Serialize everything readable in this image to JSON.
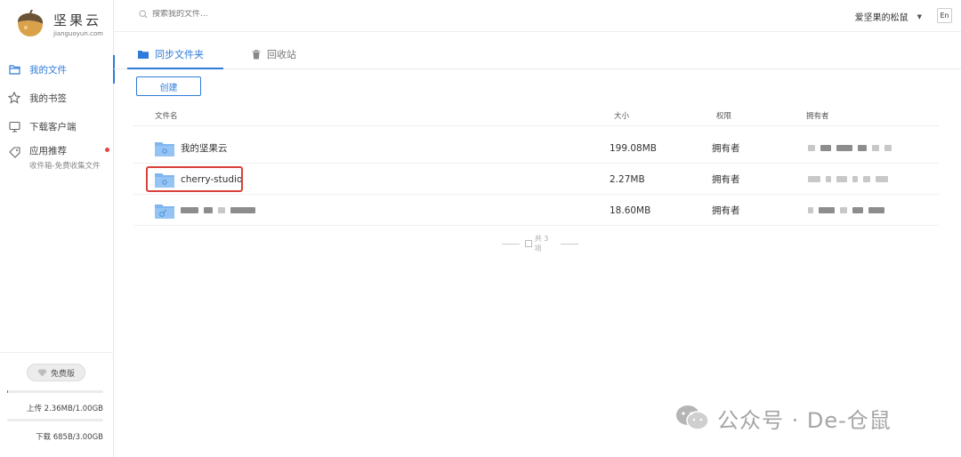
{
  "app": {
    "logo_name": "坚果云",
    "logo_domain": "jianguoyun.com"
  },
  "sidebar": {
    "items": [
      {
        "label": "我的文件",
        "icon": "folder-icon",
        "active": true
      },
      {
        "label": "我的书签",
        "icon": "star-icon",
        "active": false
      },
      {
        "label": "下载客户端",
        "icon": "monitor-icon",
        "active": false
      },
      {
        "label": "应用推荐",
        "sublabel": "收件箱-免费收集文件",
        "icon": "tag-icon",
        "active": false,
        "has_dot": true
      }
    ],
    "plan_label": "免费版",
    "upload": {
      "label": "上传 2.36MB/1.00GB",
      "fraction": 0.0023
    },
    "download": {
      "label": "下载 685B/3.00GB",
      "fraction": 0.0
    }
  },
  "topbar": {
    "search_placeholder": "搜索我的文件...",
    "username": "爱坚果的松鼠",
    "lang_button": "En"
  },
  "tabs": [
    {
      "label": "同步文件夹",
      "icon": "folder-icon",
      "active": true
    },
    {
      "label": "回收站",
      "icon": "trash-icon",
      "active": false
    }
  ],
  "toolbar": {
    "create_label": "创建"
  },
  "table": {
    "headers": {
      "name": "文件名",
      "size": "大小",
      "permission": "权限",
      "owner": "拥有者"
    },
    "rows": [
      {
        "name": "我的坚果云",
        "size": "199.08MB",
        "permission": "拥有者",
        "name_redacted": false
      },
      {
        "name": "cherry-studio",
        "size": "2.27MB",
        "permission": "拥有者",
        "name_redacted": false,
        "highlighted": true
      },
      {
        "name": "",
        "size": "18.60MB",
        "permission": "拥有者",
        "name_redacted": true
      }
    ],
    "total_label": "共 3 项"
  },
  "watermark": {
    "text": "公众号 · De-仓鼠"
  },
  "colors": {
    "accent": "#2f7bd9",
    "highlight": "#d9413a",
    "folder": "#7fb6f0"
  }
}
